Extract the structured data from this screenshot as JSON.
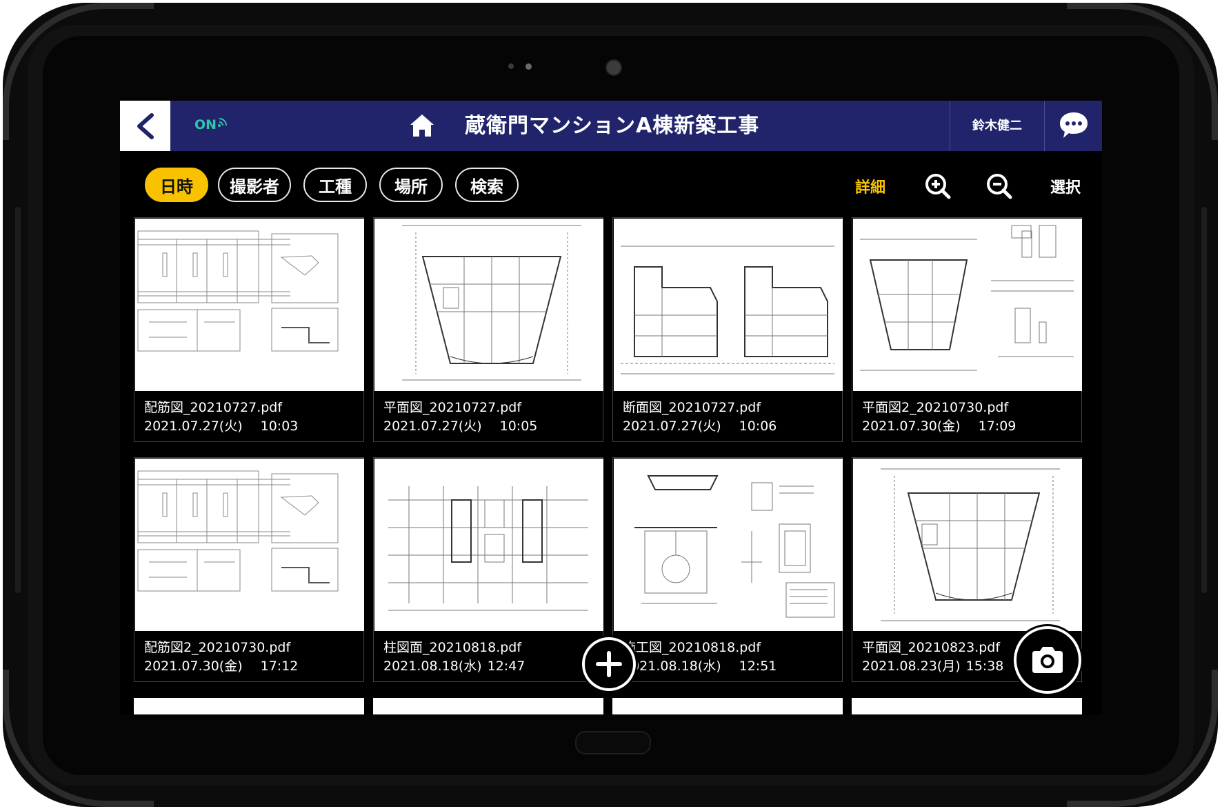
{
  "header": {
    "back_icon": "chevron-left-icon",
    "online_status": "ON",
    "home_icon": "home-icon",
    "title": "蔵衛門マンションA棟新築工事",
    "user_name": "鈴木健二",
    "chat_icon": "chat-bubble-icon"
  },
  "toolbar": {
    "filters": [
      {
        "label": "日時",
        "active": true
      },
      {
        "label": "撮影者",
        "active": false
      },
      {
        "label": "工種",
        "active": false
      },
      {
        "label": "場所",
        "active": false
      },
      {
        "label": "検索",
        "active": false
      }
    ],
    "detail_label": "詳細",
    "zoom_in_icon": "zoom-in-icon",
    "zoom_out_icon": "zoom-out-icon",
    "select_label": "選択"
  },
  "files": [
    {
      "name": "配筋図_20210727.pdf",
      "date": "2021.07.27(火)",
      "time": "10:03"
    },
    {
      "name": "平面図_20210727.pdf",
      "date": "2021.07.27(火)",
      "time": "10:05"
    },
    {
      "name": "断面図_20210727.pdf",
      "date": "2021.07.27(火)",
      "time": "10:06"
    },
    {
      "name": "平面図2_20210730.pdf",
      "date": "2021.07.30(金)",
      "time": "17:09"
    },
    {
      "name": "配筋図2_20210730.pdf",
      "date": "2021.07.30(金)",
      "time": "17:12"
    },
    {
      "name": "柱図面_20210818.pdf",
      "date": "2021.08.18(水)",
      "time": "12:47"
    },
    {
      "name": "施工図_20210818.pdf",
      "date": "2021.08.18(水)",
      "time": "12:51"
    },
    {
      "name": "平面図_20210823.pdf",
      "date": "2021.08.23(月)",
      "time": "15:38"
    }
  ],
  "fab": {
    "add_icon": "plus-icon",
    "camera_icon": "camera-icon"
  },
  "colors": {
    "header_bg": "#21246a",
    "accent": "#f8c200",
    "online": "#2ec7a9"
  }
}
